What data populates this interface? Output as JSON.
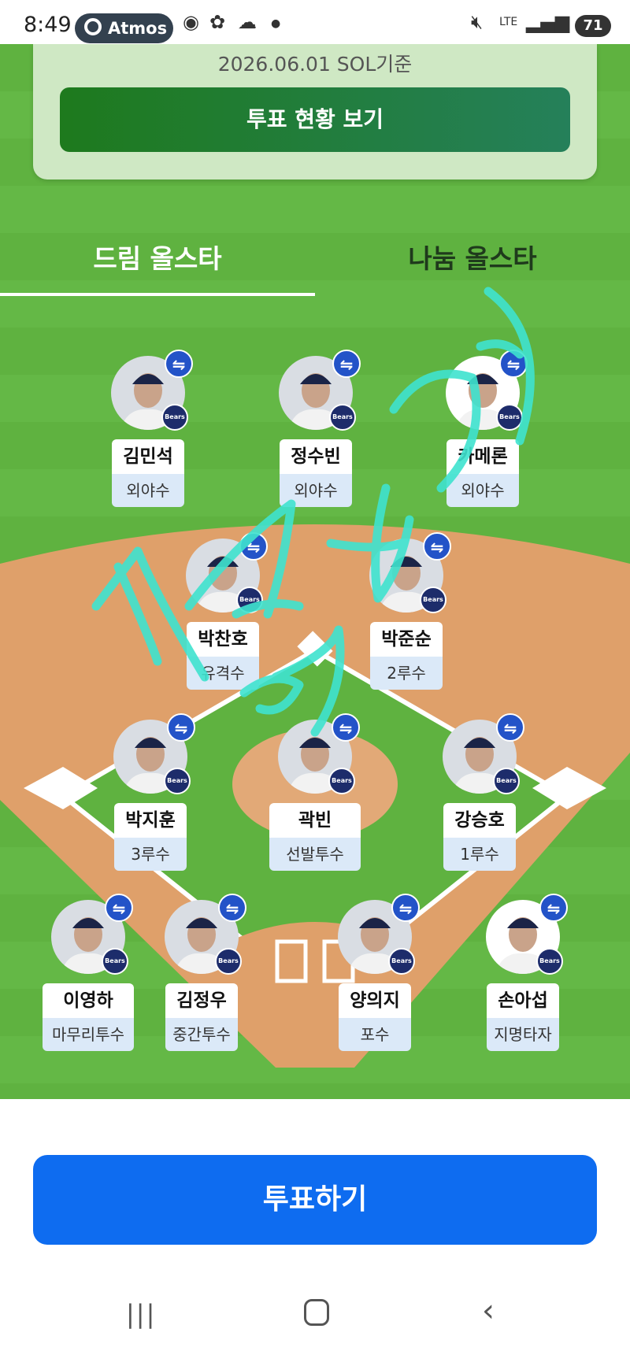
{
  "status_bar": {
    "time": "8:49",
    "app_pill": "Atmos",
    "network": "LTE",
    "battery": "71"
  },
  "card": {
    "basis_text": "2026.06.01 SOL기준",
    "status_button": "투표 현황 보기"
  },
  "tabs": [
    {
      "label": "드림 올스타",
      "active": true
    },
    {
      "label": "나눔 올스타",
      "active": false
    }
  ],
  "players": [
    {
      "name": "김민석",
      "position": "외야수"
    },
    {
      "name": "정수빈",
      "position": "외야수"
    },
    {
      "name": "카메론",
      "position": "외야수"
    },
    {
      "name": "박찬호",
      "position": "유격수"
    },
    {
      "name": "박준순",
      "position": "2루수"
    },
    {
      "name": "박지훈",
      "position": "3루수"
    },
    {
      "name": "곽빈",
      "position": "선발투수"
    },
    {
      "name": "강승호",
      "position": "1루수"
    },
    {
      "name": "이영하",
      "position": "마무리투수"
    },
    {
      "name": "김정우",
      "position": "중간투수"
    },
    {
      "name": "양의지",
      "position": "포수"
    },
    {
      "name": "손아섭",
      "position": "지명타자"
    }
  ],
  "swap_icon": "⇋",
  "team_logo": "Bears",
  "vote_button": "투표하기",
  "colors": {
    "grass": "#5fb240",
    "infield": "#dfa06a",
    "vote_button": "#0e6cf0",
    "swap_badge": "#2353c8",
    "scribble": "#3fe3cf"
  }
}
